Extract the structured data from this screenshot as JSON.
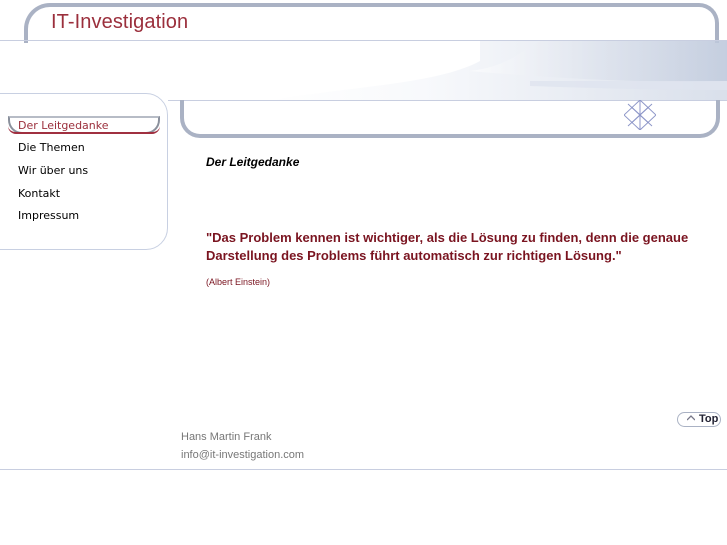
{
  "header": {
    "title": "IT-Investigation"
  },
  "sidebar": {
    "items": [
      {
        "label": "Der Leitgedanke",
        "active": true
      },
      {
        "label": "Die Themen"
      },
      {
        "label": "Wir über uns"
      },
      {
        "label": "Kontakt"
      },
      {
        "label": "Impressum"
      }
    ]
  },
  "main": {
    "heading": "Der Leitgedanke",
    "quote": "\"Das Problem kennen ist wichtiger, als die Lösung zu finden, denn die genaue Darstellung des Problems führt automatisch zur richtigen Lösung.\"",
    "author": "(Albert Einstein)",
    "top_label": "Top"
  },
  "footer": {
    "name": "Hans Martin Frank",
    "email": "info@it-investigation.com"
  },
  "colors": {
    "accent": "#9b2f3c",
    "frame": "#aab2c4",
    "quote": "#7a1420"
  },
  "icons": {
    "top_arrow": "chevron-up-icon",
    "decoration": "diamond-lattice-icon"
  }
}
